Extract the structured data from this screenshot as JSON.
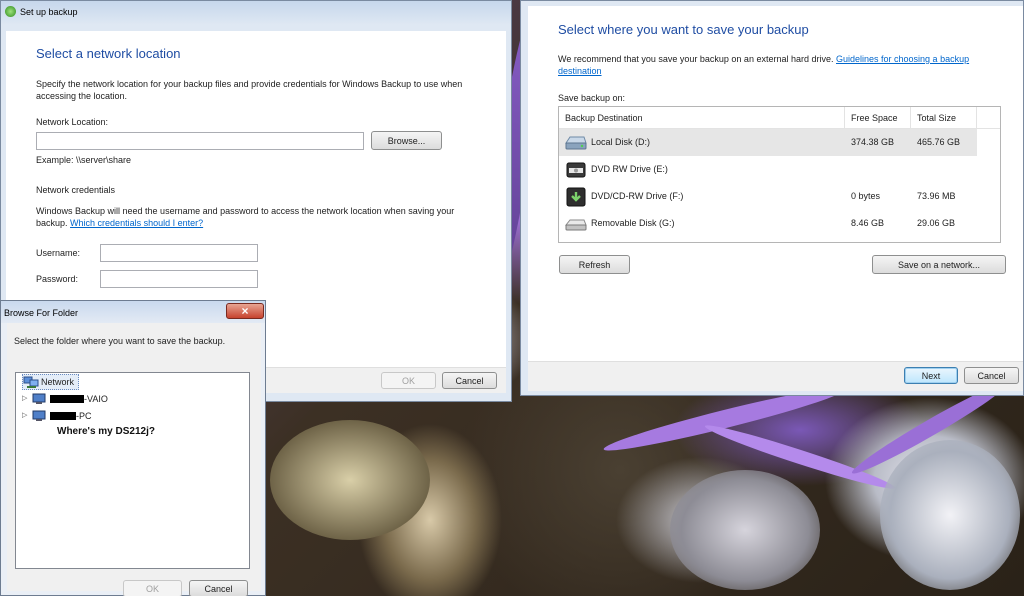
{
  "network_window": {
    "title": "Set up backup",
    "heading": "Select a network location",
    "description": "Specify the network location for your backup files and provide credentials for Windows Backup to use when accessing the location.",
    "network_location_label": "Network Location:",
    "network_location_value": "",
    "browse_label": "Browse...",
    "example_text": "Example: \\\\server\\share",
    "credentials_heading": "Network credentials",
    "credentials_text": "Windows Backup will need the username and password to access the network location when saving your backup.",
    "credentials_link": "Which credentials should I enter?",
    "username_label": "Username:",
    "username_value": "",
    "password_label": "Password:",
    "password_value": "",
    "ok_label": "OK",
    "cancel_label": "Cancel"
  },
  "save_window": {
    "heading": "Select where you want to save your backup",
    "recommend_text": "We recommend that you save your backup on an external hard drive.",
    "guidelines_link": "Guidelines for choosing a backup destination",
    "save_on_label": "Save backup on:",
    "columns": [
      "Backup Destination",
      "Free Space",
      "Total Size"
    ],
    "rows": [
      {
        "name": "Local Disk (D:)",
        "free": "374.38 GB",
        "total": "465.76 GB",
        "icon": "hard-disk-icon",
        "selected": true
      },
      {
        "name": "DVD RW Drive (E:)",
        "free": "",
        "total": "",
        "icon": "dvd-drive-icon",
        "selected": false
      },
      {
        "name": "DVD/CD-RW Drive (F:)",
        "free": "0 bytes",
        "total": "73.96 MB",
        "icon": "cd-drive-icon",
        "selected": false
      },
      {
        "name": "Removable Disk (G:)",
        "free": "8.46 GB",
        "total": "29.06 GB",
        "icon": "removable-disk-icon",
        "selected": false
      }
    ],
    "refresh_label": "Refresh",
    "save_network_label": "Save on a network...",
    "next_label": "Next",
    "cancel_label": "Cancel"
  },
  "browse_dialog": {
    "title": "Browse For Folder",
    "close_glyph": "×",
    "instruction": "Select the folder where you want to save the backup.",
    "tree": {
      "root": "Network",
      "children": [
        "-VAIO",
        "-PC"
      ]
    },
    "annotation": "Where's my DS212j?",
    "ok_label": "OK",
    "cancel_label": "Cancel"
  }
}
